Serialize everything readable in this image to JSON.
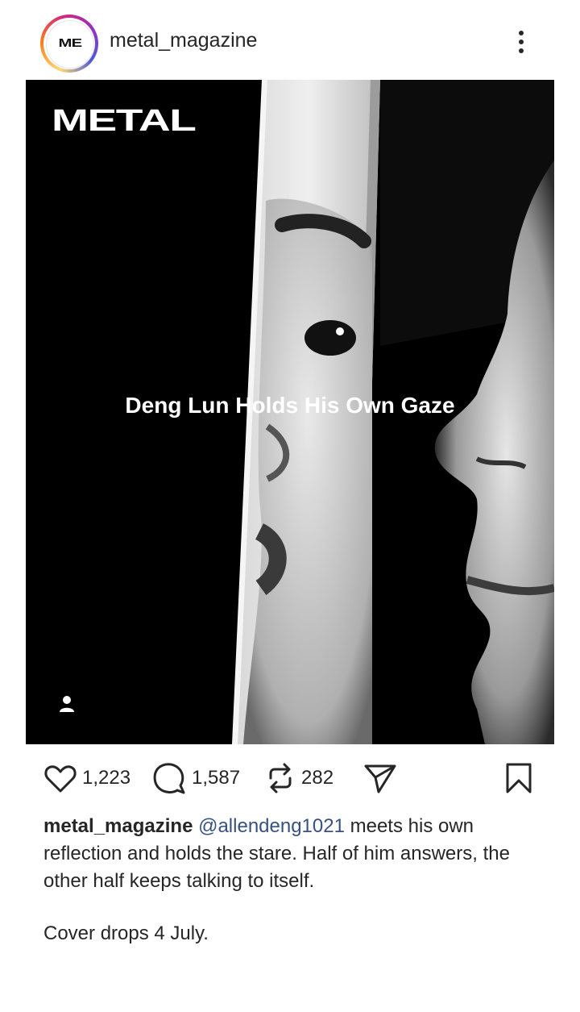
{
  "header": {
    "avatar_text": "ME",
    "username": "metal_magazine"
  },
  "post": {
    "brand": "METAL",
    "headline": "Deng Lun Holds His Own Gaze"
  },
  "actions": {
    "likes": "1,223",
    "comments": "1,587",
    "reposts": "282"
  },
  "caption": {
    "username": "metal_magazine",
    "mention": "@allendeng1021",
    "text": " meets his own reflection and holds the stare. Half of him answers, the other half keeps talking to itself.",
    "extra": "Cover drops 4 July."
  },
  "icons": {
    "more": "more-vertical-icon",
    "tag": "user-tag-icon",
    "like": "heart-icon",
    "comment": "comment-icon",
    "repost": "repost-icon",
    "share": "send-icon",
    "save": "bookmark-icon"
  }
}
